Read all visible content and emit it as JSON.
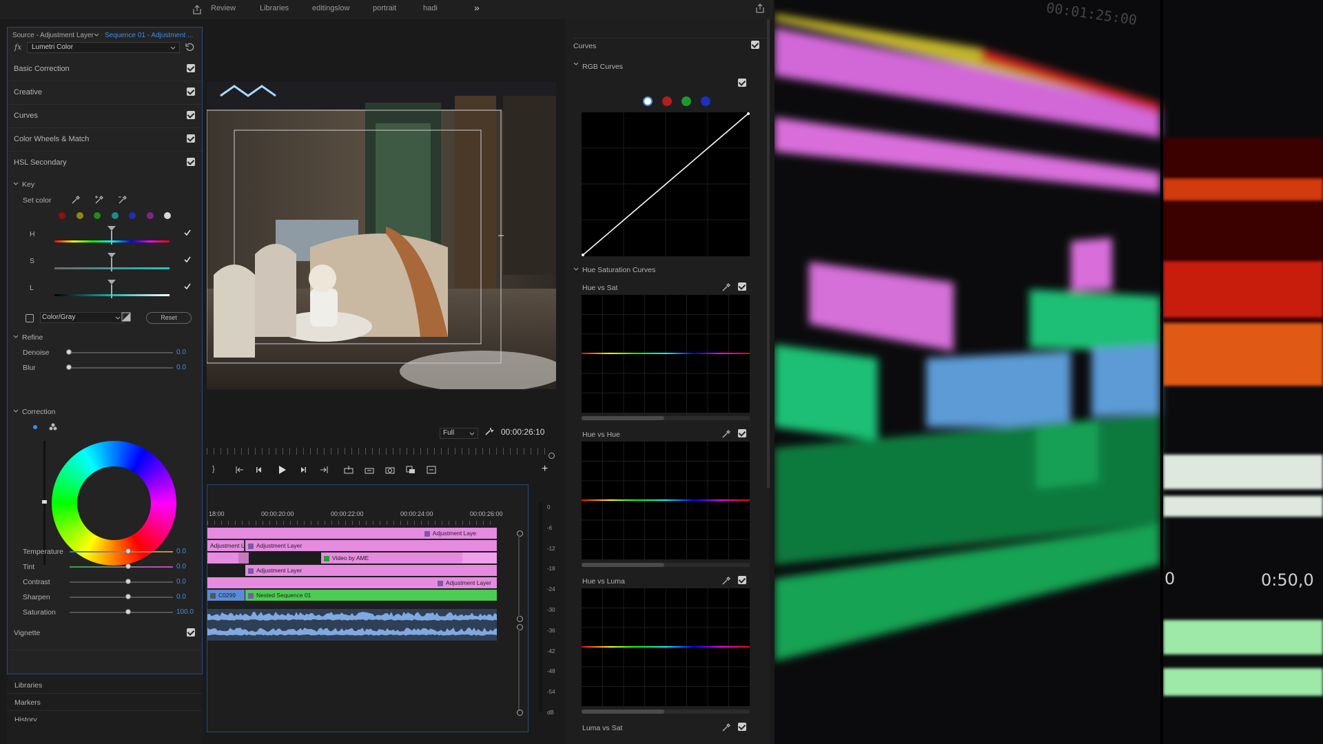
{
  "topbar": {
    "tabs": [
      "Review",
      "Libraries",
      "editingslow",
      "portrait",
      "hadi"
    ],
    "more": "»"
  },
  "left_panel": {
    "source_label": "Source - Adjustment Layer",
    "sequence_label": "Sequence 01 - Adjustment ...",
    "fx_label": "fx",
    "effect_name": "Lumetri Color",
    "sections": [
      "Basic Correction",
      "Creative",
      "Curves",
      "Color Wheels & Match",
      "HSL Secondary"
    ],
    "key": {
      "title": "Key",
      "set_color": "Set color",
      "swatches": [
        "#8e1010",
        "#8a8a12",
        "#22891f",
        "#1f8b8b",
        "#1f2fb8",
        "#8a1f8a",
        "#d8d8d8"
      ],
      "h": "H",
      "s": "S",
      "l": "L",
      "color_gray": "Color/Gray",
      "reset": "Reset"
    },
    "refine": {
      "title": "Refine",
      "denoise": "Denoise",
      "denoise_val": "0.0",
      "blur": "Blur",
      "blur_val": "0.0"
    },
    "correction": {
      "title": "Correction",
      "params": [
        {
          "label": "Temperature",
          "value": "0.0"
        },
        {
          "label": "Tint",
          "value": "0.0"
        },
        {
          "label": "Contrast",
          "value": "0.0"
        },
        {
          "label": "Sharpen",
          "value": "0.0"
        },
        {
          "label": "Saturation",
          "value": "100.0"
        }
      ]
    },
    "vignette": "Vignette",
    "bottom_tabs": [
      "Libraries",
      "Markers",
      "History"
    ]
  },
  "monitor": {
    "zoom": "Full",
    "timecode": "00:00:26:10"
  },
  "timeline": {
    "ruler": [
      "18:00",
      "00:00:20:00",
      "00:00:22:00",
      "00:00:24:00",
      "00:00:26:00"
    ],
    "clips": {
      "adj_top": "Adjustment Laye",
      "adj_l": "Adjustment L",
      "adj_layer": "Adjustment Layer",
      "video_ame": "Video by AME",
      "adj_layer2": "Adjustment Layer",
      "adj_layer3": "Adjustment Layer",
      "c0299": "C0299",
      "nested": "Nested Sequence 01"
    },
    "meter": [
      "0",
      "-6",
      "-12",
      "-18",
      "-24",
      "-30",
      "-36",
      "-42",
      "-48",
      "-54",
      "dB"
    ]
  },
  "right_panel": {
    "curves": "Curves",
    "rgb_curves": "RGB Curves",
    "channel_colors": [
      "#ffffff",
      "#b51c1c",
      "#1c9a2c",
      "#1c2fc0"
    ],
    "hue_sat_curves": "Hue Saturation Curves",
    "graphs": [
      "Hue vs Sat",
      "Hue vs Hue",
      "Hue vs Luma",
      "Luma vs Sat"
    ]
  },
  "photo": {
    "timecode_top": "00:01:25:00",
    "timecode_mid": "0:50,0",
    "label_zero": "0"
  }
}
